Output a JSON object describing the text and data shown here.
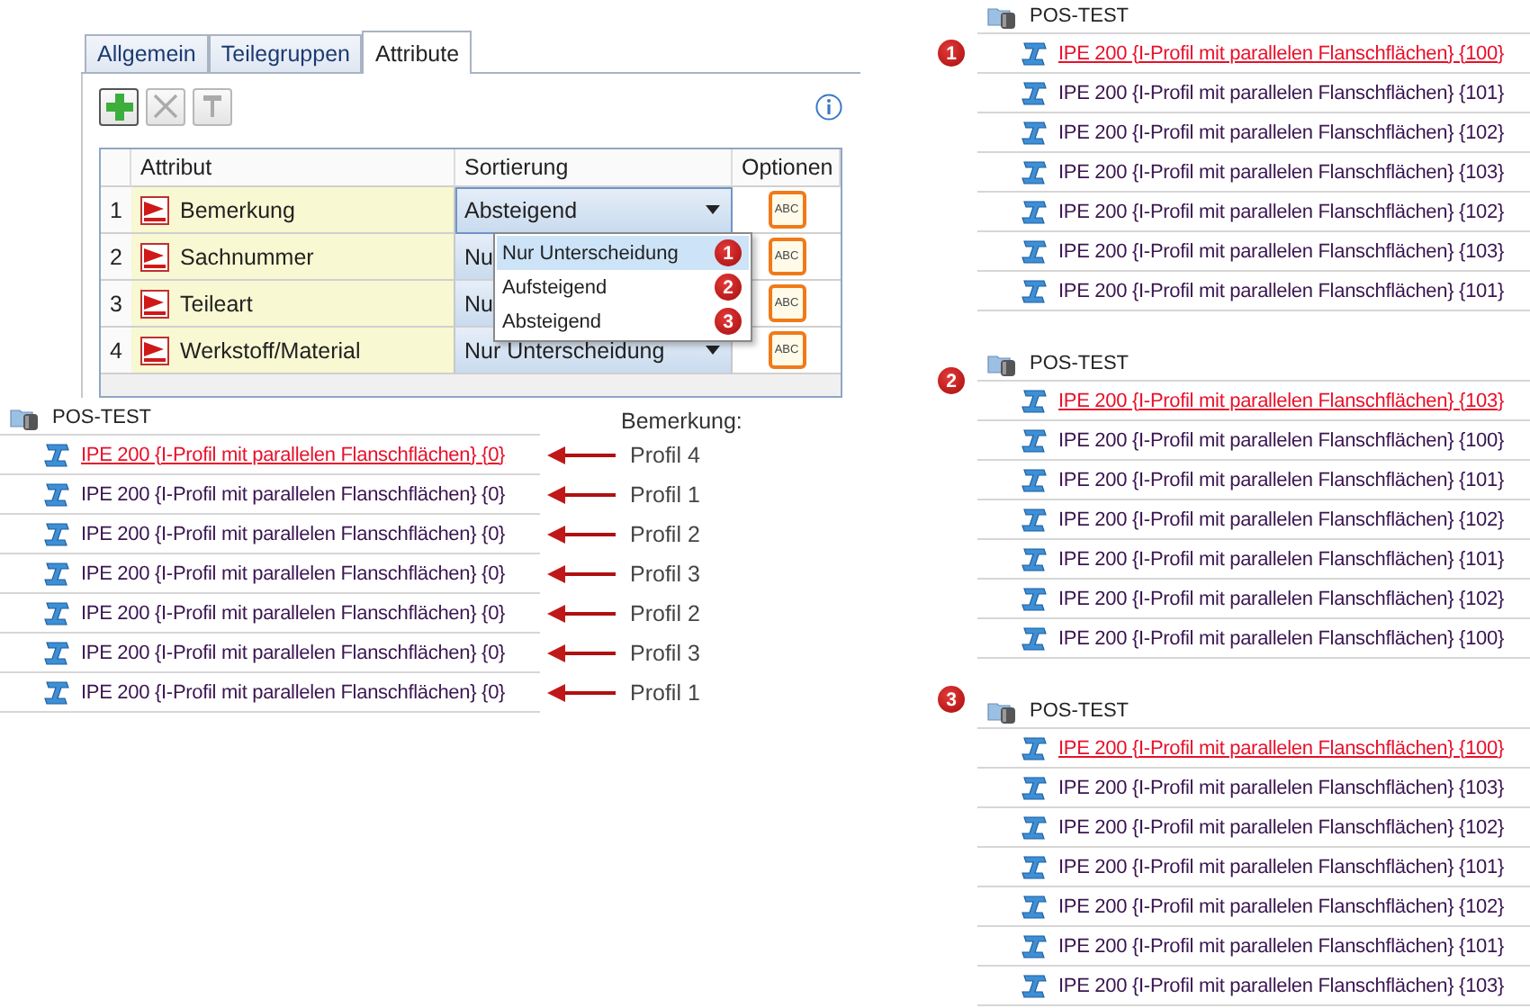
{
  "dialog": {
    "tabs": [
      {
        "label": "Allgemein",
        "selected": false
      },
      {
        "label": "Teilegruppen",
        "selected": false
      },
      {
        "label": "Attribute",
        "selected": true
      }
    ],
    "toolbar": [
      {
        "kind": "add",
        "disabled": false
      },
      {
        "kind": "delete",
        "disabled": true
      },
      {
        "kind": "edit",
        "disabled": true
      }
    ],
    "columns": [
      "Attribut",
      "Sortierung",
      "Optionen"
    ],
    "rows": [
      {
        "number": "1",
        "attribute": "Bemerkung",
        "sorting": "Absteigend",
        "open": true,
        "option": "ABC"
      },
      {
        "number": "2",
        "attribute": "Sachnummer",
        "sorting": "Nu",
        "open": false,
        "option": "ABC"
      },
      {
        "number": "3",
        "attribute": "Teileart",
        "sorting": "Nu",
        "open": false,
        "option": "ABC"
      },
      {
        "number": "4",
        "attribute": "Werkstoff/Material",
        "sorting": "Nur Unterscheidung",
        "open": false,
        "option": "ABC"
      }
    ],
    "dropdown": [
      {
        "label": "Nur Unterscheidung",
        "selected": true,
        "badge": "1"
      },
      {
        "label": "Aufsteigend",
        "selected": false,
        "badge": "2"
      },
      {
        "label": "Absteigend",
        "selected": false,
        "badge": "3"
      }
    ]
  },
  "example": {
    "title": "POS-TEST",
    "annotation_title": "Bemerkung:",
    "items": [
      {
        "label": "IPE 200 {I-Profil mit parallelen Flanschflächen} {0}",
        "selected": true,
        "note": "Profil 4"
      },
      {
        "label": "IPE 200 {I-Profil mit parallelen Flanschflächen} {0}",
        "selected": false,
        "note": "Profil 1"
      },
      {
        "label": "IPE 200 {I-Profil mit parallelen Flanschflächen} {0}",
        "selected": false,
        "note": "Profil 2"
      },
      {
        "label": "IPE 200 {I-Profil mit parallelen Flanschflächen} {0}",
        "selected": false,
        "note": "Profil 3"
      },
      {
        "label": "IPE 200 {I-Profil mit parallelen Flanschflächen} {0}",
        "selected": false,
        "note": "Profil 2"
      },
      {
        "label": "IPE 200 {I-Profil mit parallelen Flanschflächen} {0}",
        "selected": false,
        "note": "Profil 3"
      },
      {
        "label": "IPE 200 {I-Profil mit parallelen Flanschflächen} {0}",
        "selected": false,
        "note": "Profil 1"
      }
    ]
  },
  "results": [
    {
      "badge": "1",
      "title": "POS-TEST",
      "items": [
        {
          "label": "IPE 200 {I-Profil mit parallelen Flanschflächen} {100}",
          "selected": true
        },
        {
          "label": "IPE 200 {I-Profil mit parallelen Flanschflächen} {101}",
          "selected": false
        },
        {
          "label": "IPE 200 {I-Profil mit parallelen Flanschflächen} {102}",
          "selected": false
        },
        {
          "label": "IPE 200 {I-Profil mit parallelen Flanschflächen} {103}",
          "selected": false
        },
        {
          "label": "IPE 200 {I-Profil mit parallelen Flanschflächen} {102}",
          "selected": false
        },
        {
          "label": "IPE 200 {I-Profil mit parallelen Flanschflächen} {103}",
          "selected": false
        },
        {
          "label": "IPE 200 {I-Profil mit parallelen Flanschflächen} {101}",
          "selected": false
        }
      ]
    },
    {
      "badge": "2",
      "title": "POS-TEST",
      "items": [
        {
          "label": "IPE 200 {I-Profil mit parallelen Flanschflächen} {103}",
          "selected": true
        },
        {
          "label": "IPE 200 {I-Profil mit parallelen Flanschflächen} {100}",
          "selected": false
        },
        {
          "label": "IPE 200 {I-Profil mit parallelen Flanschflächen} {101}",
          "selected": false
        },
        {
          "label": "IPE 200 {I-Profil mit parallelen Flanschflächen} {102}",
          "selected": false
        },
        {
          "label": "IPE 200 {I-Profil mit parallelen Flanschflächen} {101}",
          "selected": false
        },
        {
          "label": "IPE 200 {I-Profil mit parallelen Flanschflächen} {102}",
          "selected": false
        },
        {
          "label": "IPE 200 {I-Profil mit parallelen Flanschflächen} {100}",
          "selected": false
        }
      ]
    },
    {
      "badge": "3",
      "title": "POS-TEST",
      "items": [
        {
          "label": "IPE 200 {I-Profil mit parallelen Flanschflächen} {100}",
          "selected": true
        },
        {
          "label": "IPE 200 {I-Profil mit parallelen Flanschflächen} {103}",
          "selected": false
        },
        {
          "label": "IPE 200 {I-Profil mit parallelen Flanschflächen} {102}",
          "selected": false
        },
        {
          "label": "IPE 200 {I-Profil mit parallelen Flanschflächen} {101}",
          "selected": false
        },
        {
          "label": "IPE 200 {I-Profil mit parallelen Flanschflächen} {102}",
          "selected": false
        },
        {
          "label": "IPE 200 {I-Profil mit parallelen Flanschflächen} {101}",
          "selected": false
        },
        {
          "label": "IPE 200 {I-Profil mit parallelen Flanschflächen} {103}",
          "selected": false
        }
      ]
    }
  ]
}
